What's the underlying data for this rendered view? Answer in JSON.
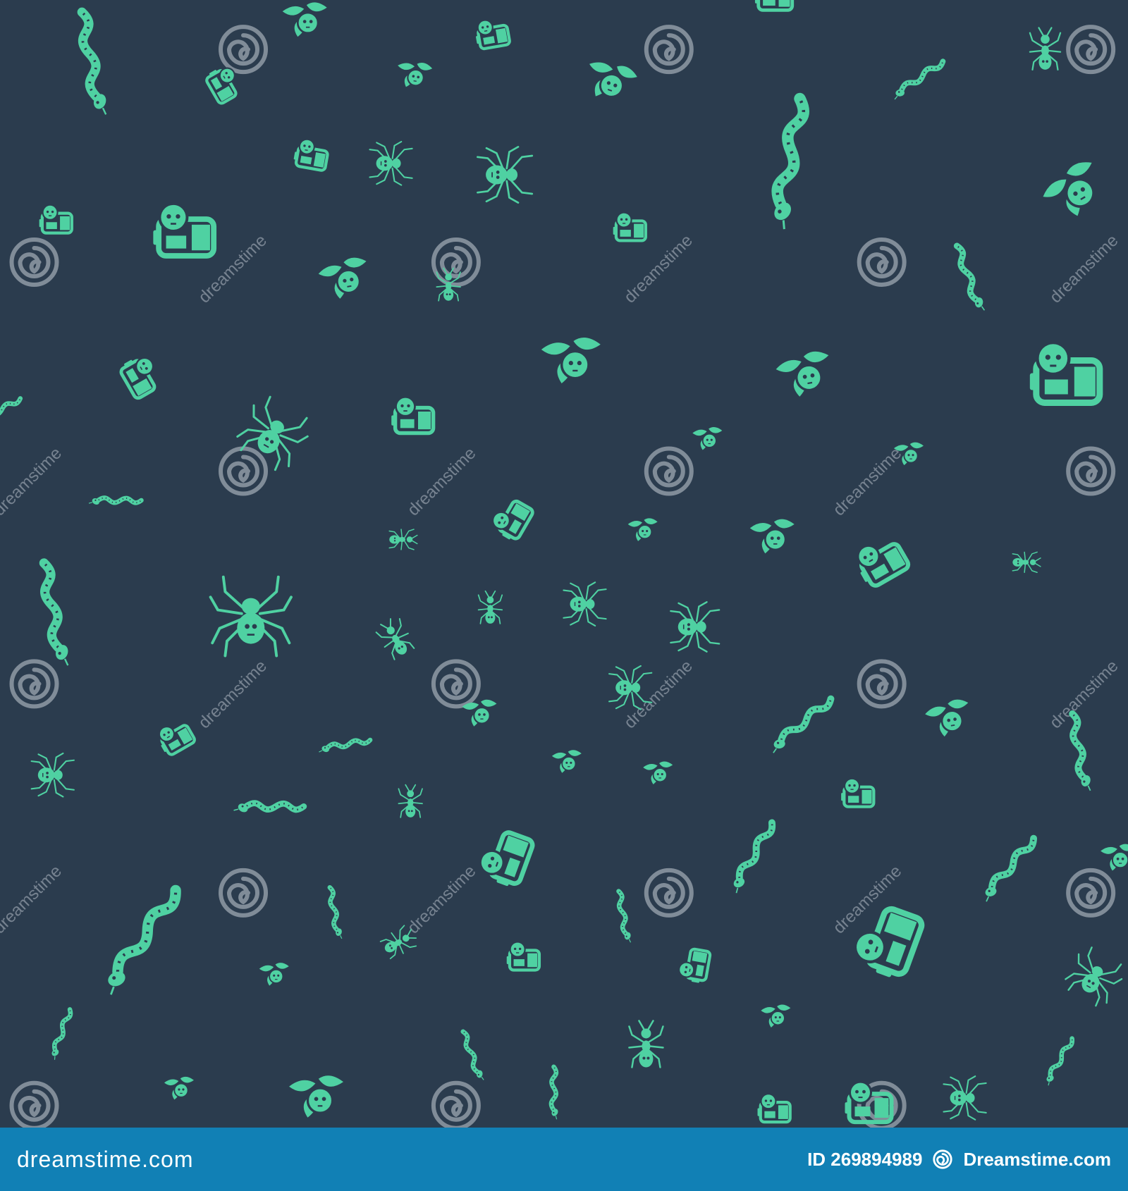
{
  "colors": {
    "background": "#2b3c4e",
    "icon": "#4fd1a2",
    "watermark": "#8f9aa6",
    "footer": "#1180b5",
    "footer_text": "#ffffff"
  },
  "pattern": {
    "icon_types": [
      "snake-icon",
      "spider-icon",
      "ant-icon",
      "poison-drops-skull-icon",
      "poison-bottle-skull-icon"
    ],
    "watermark_text": "dreamstime",
    "watermark_icon": "spiral-logo-icon"
  },
  "footer": {
    "brand_left": "dreamstime.com",
    "id_text": "ID 269894989",
    "brand_right": "Dreamstime.com"
  }
}
